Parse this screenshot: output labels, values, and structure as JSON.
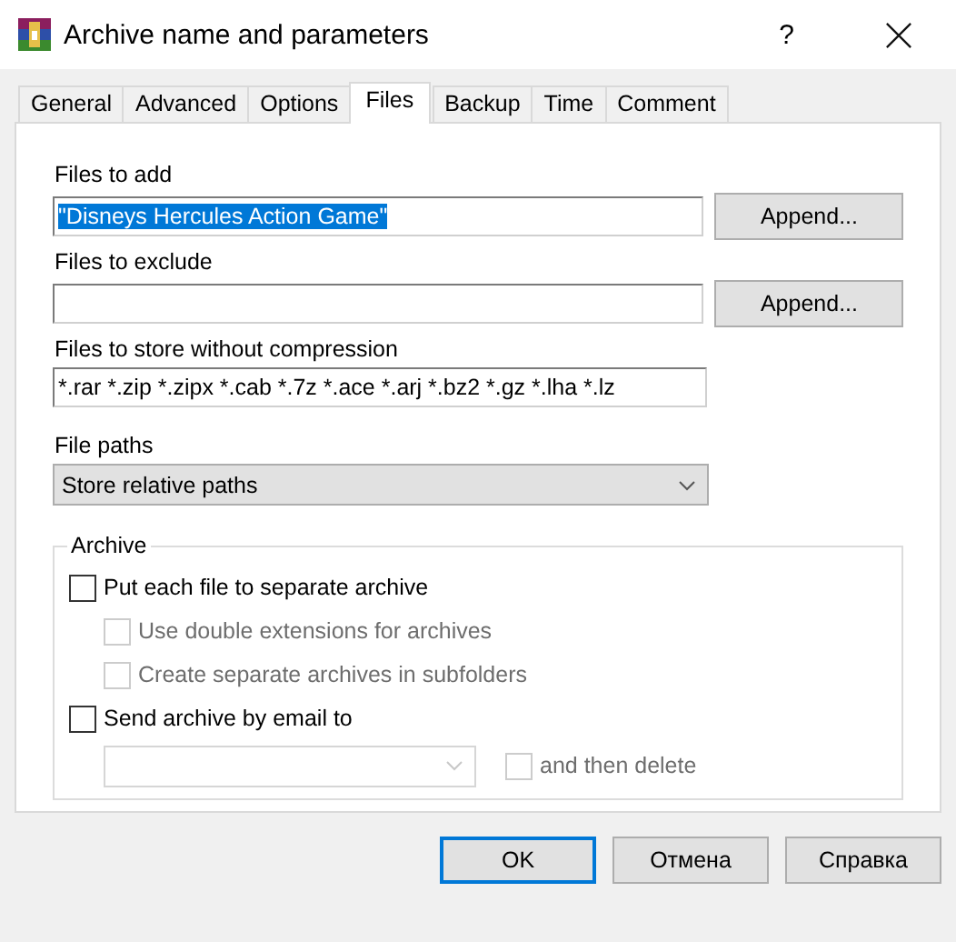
{
  "window": {
    "title": "Archive name and parameters",
    "help": "?"
  },
  "tabs": [
    {
      "label": "General",
      "selected": false
    },
    {
      "label": "Advanced",
      "selected": false
    },
    {
      "label": "Options",
      "selected": false
    },
    {
      "label": "Files",
      "selected": true
    },
    {
      "label": "Backup",
      "selected": false
    },
    {
      "label": "Time",
      "selected": false
    },
    {
      "label": "Comment",
      "selected": false
    }
  ],
  "fields": [
    {
      "label": "Files to add",
      "value": "\"Disneys Hercules Action Game\"",
      "text_selected": true,
      "button": "Append..."
    },
    {
      "label": "Files to exclude",
      "button": "Append..."
    },
    {
      "label": "Files to store without compression",
      "value": "*.rar *.zip *.zipx *.cab *.7z *.ace *.arj *.bz2 *.gz *.lha *.lz",
      "text_selected": false
    }
  ],
  "file_paths": {
    "label": "File paths",
    "value": "Store relative paths"
  },
  "archive_group": {
    "title": "Archive",
    "options": [
      {
        "kind": "checkbox",
        "label": "Put each file to separate archive",
        "checked": false,
        "disabled": false,
        "children": [
          {
            "kind": "checkbox",
            "label": "Use double extensions for archives",
            "checked": false,
            "disabled": true
          },
          {
            "kind": "checkbox",
            "label": "Create separate archives in subfolders",
            "checked": false,
            "disabled": true
          }
        ]
      },
      {
        "kind": "checkbox",
        "label": "Send archive by email to",
        "checked": false,
        "disabled": false,
        "children": [
          {
            "kind": "email_row",
            "combo_disabled": true,
            "option": {
              "label": "and then delete",
              "checked": false,
              "disabled": true
            }
          }
        ]
      }
    ]
  },
  "buttons": [
    {
      "label": "OK",
      "default": true
    },
    {
      "label": "Отмена",
      "default": false
    },
    {
      "label": "Справка",
      "default": false
    }
  ]
}
